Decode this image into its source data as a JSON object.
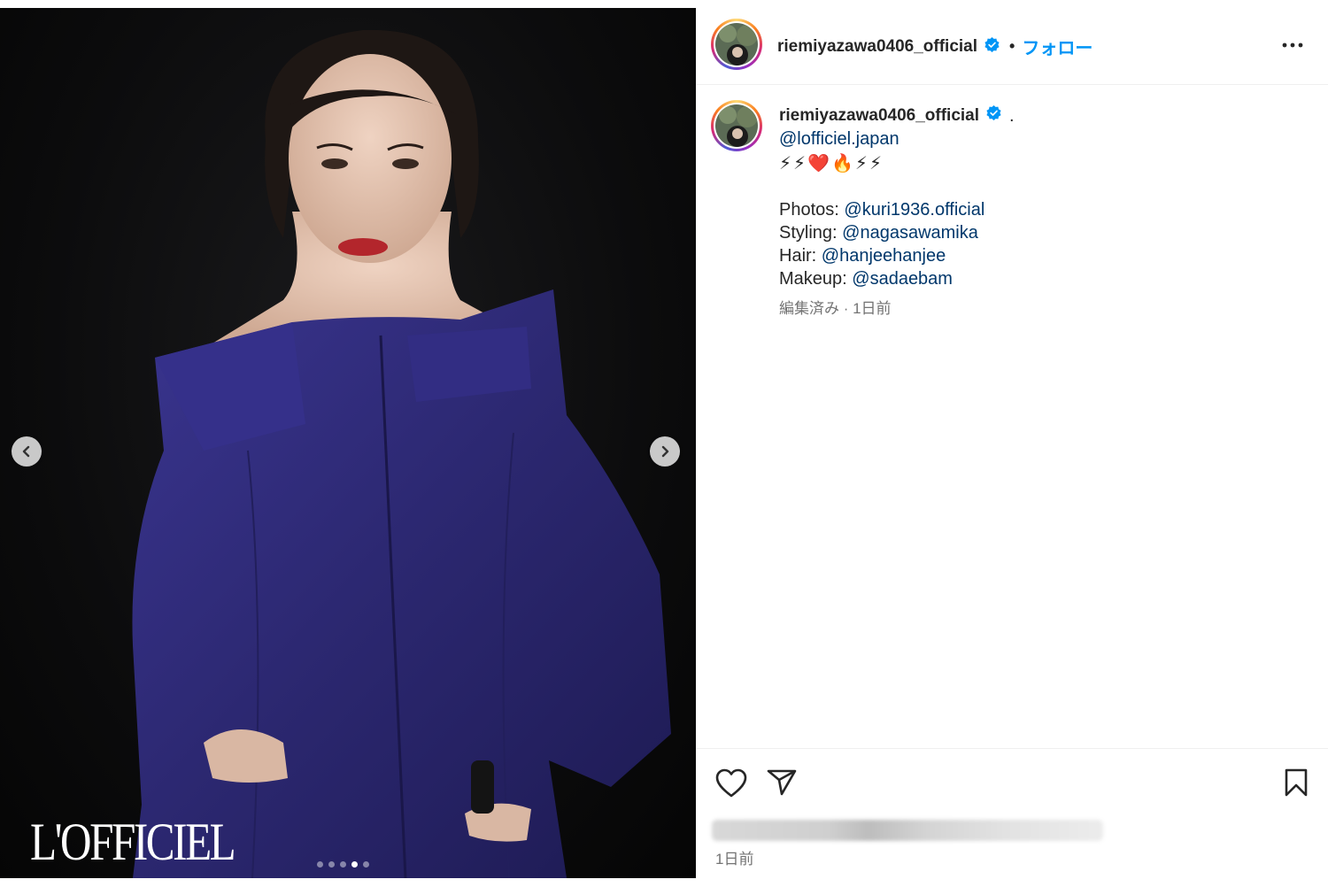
{
  "post": {
    "username": "riemiyazawa0406_official",
    "follow_label": "フォロー",
    "separator": "•",
    "magazine_logo": "L'OFFICIEL",
    "carousel": {
      "total": 5,
      "active_index": 3
    }
  },
  "caption": {
    "username": "riemiyazawa0406_official",
    "trailing": ".",
    "tag_line": "@lofficiel.japan",
    "emojis": [
      "⚡",
      "⚡",
      "❤️",
      "🔥",
      "⚡",
      "⚡"
    ],
    "credits": [
      {
        "label": "Photos:",
        "mention": "@kuri1936.official"
      },
      {
        "label": "Styling:",
        "mention": "@nagasawamika"
      },
      {
        "label": "Hair:",
        "mention": "@hanjeehanjee"
      },
      {
        "label": "Makeup:",
        "mention": "@sadaebam"
      }
    ],
    "meta": "編集済み · 1日前"
  },
  "footer": {
    "timestamp": "1日前"
  },
  "colors": {
    "follow_blue": "#0095f6",
    "mention": "#00376b",
    "dress": "#2e2a78",
    "verified": "#0095f6"
  },
  "icons": [
    "chevron-left-icon",
    "chevron-right-icon",
    "verified-icon",
    "more-icon",
    "heart-icon",
    "share-icon",
    "bookmark-icon"
  ]
}
